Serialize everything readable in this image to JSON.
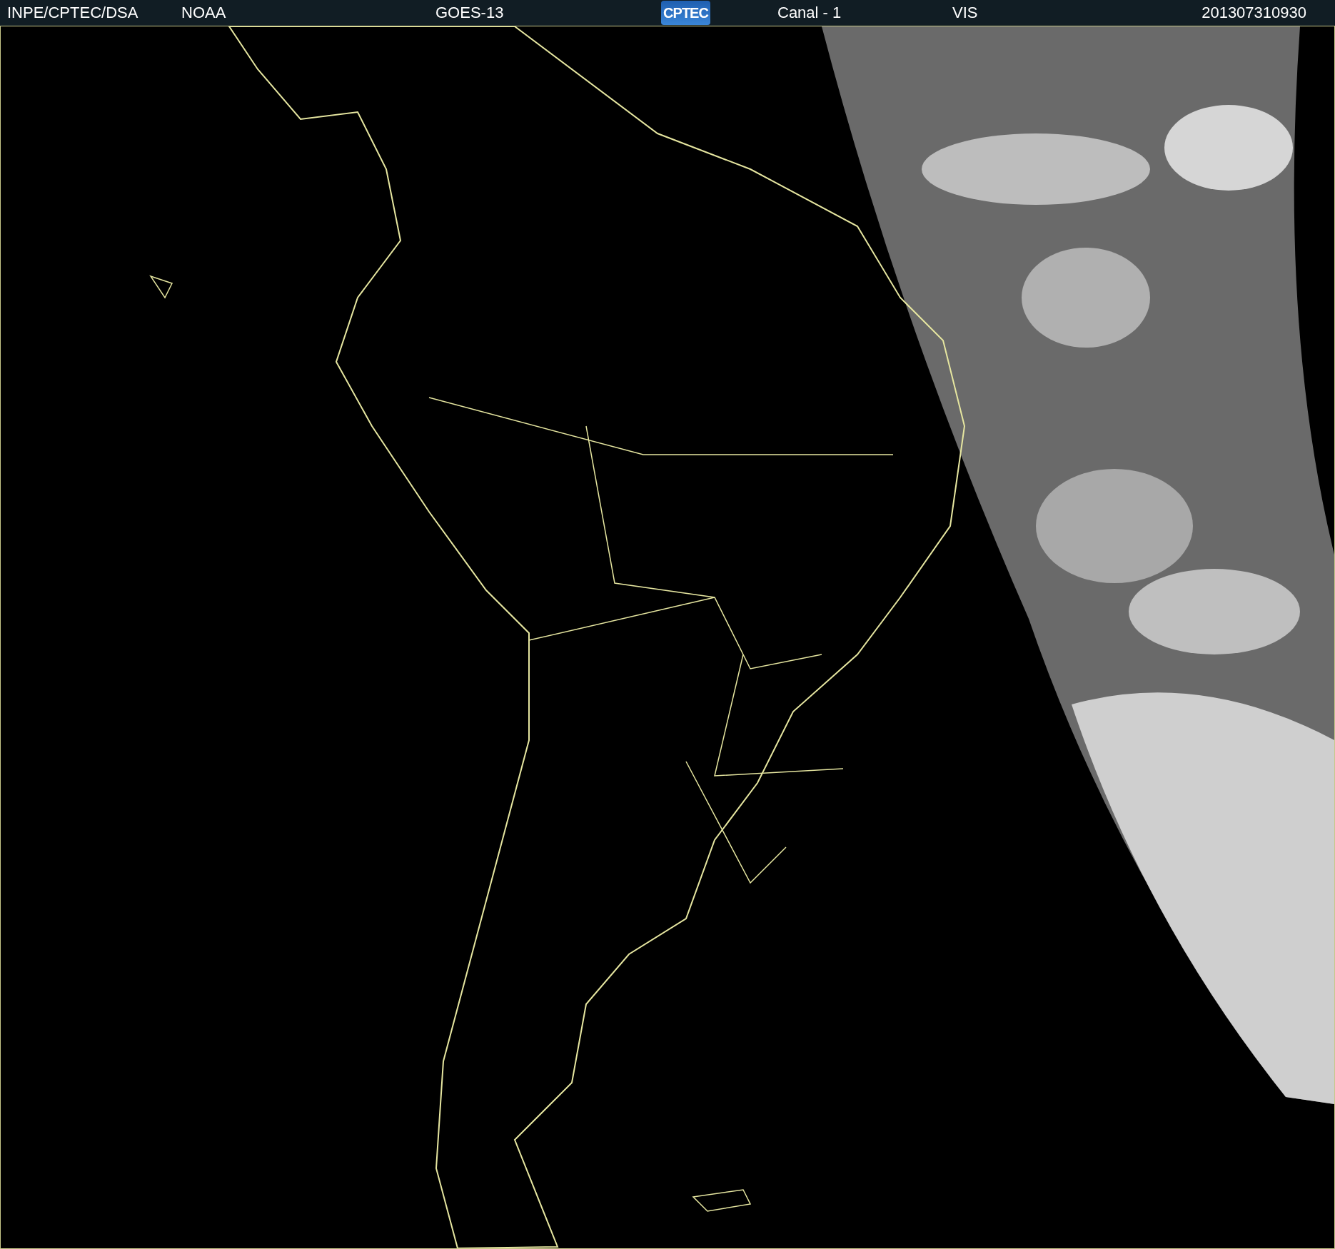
{
  "header": {
    "items": [
      {
        "kind": "text",
        "text": "INPE/CPTEC/DSA"
      },
      {
        "kind": "text",
        "text": "NOAA"
      },
      {
        "kind": "text",
        "text": "GOES-13"
      },
      {
        "kind": "logo",
        "text": "CPTEC"
      },
      {
        "kind": "text",
        "text": "Canal - 1"
      },
      {
        "kind": "text",
        "text": "VIS"
      },
      {
        "kind": "text",
        "text": "201307310930"
      }
    ]
  }
}
